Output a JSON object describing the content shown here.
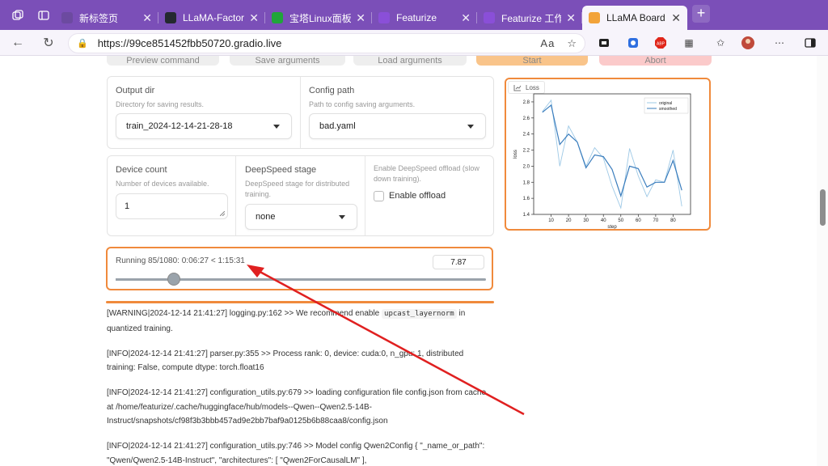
{
  "tabs": [
    {
      "label": "新标签页",
      "color": "#6c4aa0",
      "icon": "newtab-icon"
    },
    {
      "label": "LLaMA-Factory/dat",
      "color": "#24292f",
      "icon": "github-icon"
    },
    {
      "label": "宝塔Linux面板",
      "color": "#20a53a",
      "icon": "shield-icon"
    },
    {
      "label": "Featurize",
      "color": "#8a4fd8",
      "icon": "featurize-icon"
    },
    {
      "label": "Featurize 工作区",
      "color": "#8a4fd8",
      "icon": "featurize-icon"
    },
    {
      "label": "LLaMA Board (feat",
      "color": "#f2a33a",
      "icon": "gradio-icon"
    }
  ],
  "address": {
    "url": "https://99ce851452fbb50720.gradio.live"
  },
  "top_buttons": [
    "Preview command",
    "Save arguments",
    "Load arguments",
    "Start",
    "Abort"
  ],
  "output_dir": {
    "label": "Output dir",
    "info": "Directory for saving results.",
    "value": "train_2024-12-14-21-28-18"
  },
  "config_path": {
    "label": "Config path",
    "info": "Path to config saving arguments.",
    "value": "bad.yaml"
  },
  "device_count": {
    "label": "Device count",
    "info": "Number of devices available.",
    "value": "1"
  },
  "deepspeed": {
    "label": "DeepSpeed stage",
    "info": "DeepSpeed stage for distributed training.",
    "value": "none"
  },
  "offload": {
    "info": "Enable DeepSpeed offload (slow down training).",
    "label": "Enable offload",
    "checked": false
  },
  "progress": {
    "text": "Running 85/1080: 0:06:27 < 1:15:31",
    "value": "7.87",
    "fraction": 0.0787
  },
  "loss_panel": {
    "label": "Loss"
  },
  "chart_data": {
    "type": "line",
    "title": "",
    "xlabel": "step",
    "ylabel": "loss",
    "xlim": [
      0,
      90
    ],
    "ylim": [
      1.4,
      2.9
    ],
    "xticks": [
      10,
      20,
      30,
      40,
      50,
      60,
      70,
      80
    ],
    "yticks": [
      1.4,
      1.6,
      1.8,
      2.0,
      2.2,
      2.4,
      2.6,
      2.8
    ],
    "legend_position": "top-right",
    "series": [
      {
        "name": "original",
        "color": "#9ec9e6",
        "x": [
          5,
          10,
          15,
          20,
          25,
          30,
          35,
          40,
          45,
          50,
          55,
          60,
          65,
          70,
          75,
          80,
          85
        ],
        "y": [
          2.68,
          2.82,
          2.0,
          2.5,
          2.3,
          2.0,
          2.23,
          2.1,
          1.75,
          1.48,
          2.22,
          1.88,
          1.62,
          1.83,
          1.8,
          2.2,
          1.5
        ]
      },
      {
        "name": "smoothed",
        "color": "#3a7dbd",
        "x": [
          5,
          10,
          15,
          20,
          25,
          30,
          35,
          40,
          45,
          50,
          55,
          60,
          65,
          70,
          75,
          80,
          85
        ],
        "y": [
          2.67,
          2.76,
          2.27,
          2.4,
          2.3,
          1.98,
          2.14,
          2.12,
          1.96,
          1.63,
          2.0,
          1.97,
          1.74,
          1.8,
          1.8,
          2.07,
          1.7
        ]
      }
    ]
  },
  "log_lines": [
    {
      "pre": "[WARNING|2024-12-14 21:41:27] logging.py:162 >> We recommend enable ",
      "code": "upcast_layernorm",
      "post": " in quantized training."
    },
    {
      "pre": "[INFO|2024-12-14 21:41:27] parser.py:355 >> Process rank: 0, device: cuda:0, n_gpu: 1, distributed training: False, compute dtype: torch.float16",
      "code": "",
      "post": ""
    },
    {
      "pre": "[INFO|2024-12-14 21:41:27] configuration_utils.py:679 >> loading configuration file config.json from cache at /home/featurize/.cache/huggingface/hub/models--Qwen--Qwen2.5-14B-Instruct/snapshots/cf98f3b3bbb457ad9e2bb7baf9a0125b6b88caa8/config.json",
      "code": "",
      "post": ""
    },
    {
      "pre": "[INFO|2024-12-14 21:41:27] configuration_utils.py:746 >> Model config Qwen2Config { \"_name_or_path\": \"Qwen/Qwen2.5-14B-Instruct\", \"architectures\": [ \"Qwen2ForCausalLM\" ],",
      "code": "",
      "post": ""
    }
  ],
  "colors": {
    "accent": "#f08a3c",
    "browser_frame": "#7b4fb8",
    "annotation_arrow": "#e02020"
  }
}
